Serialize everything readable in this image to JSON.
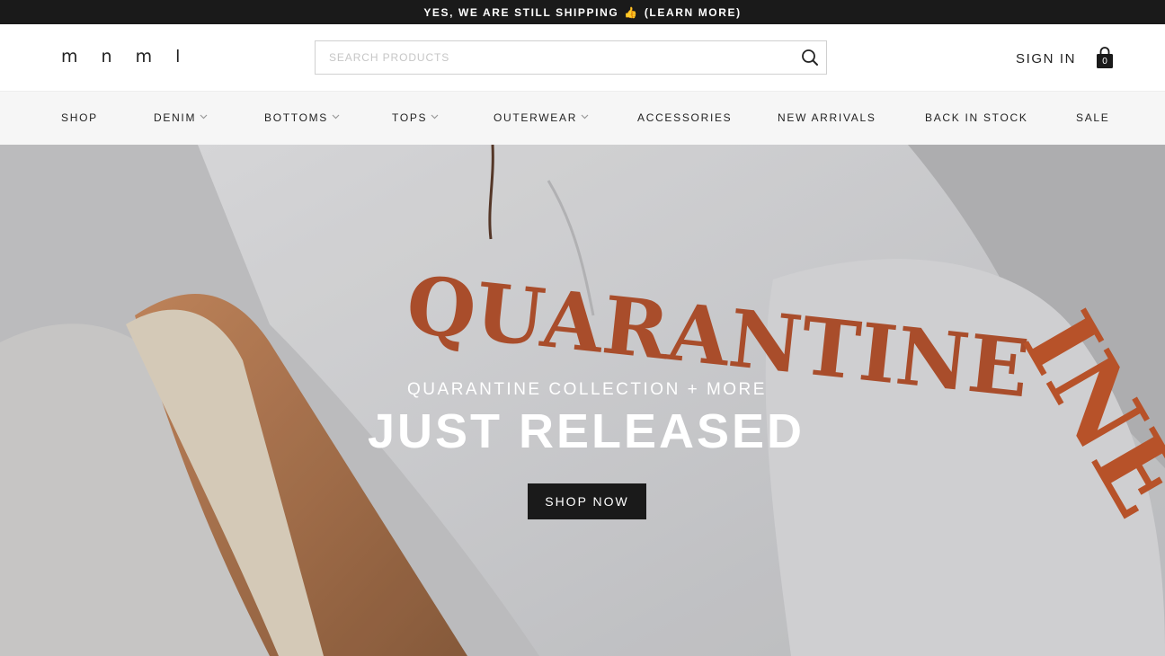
{
  "announcement": {
    "text": "YES, WE ARE STILL SHIPPING",
    "emoji": "👍",
    "link": "(LEARN MORE)"
  },
  "header": {
    "logo": "m n m l",
    "search_placeholder": "SEARCH PRODUCTS",
    "search_icon": "search-icon",
    "sign_in": "SIGN IN",
    "cart_icon": "shopping-bag-icon",
    "cart_count": "0"
  },
  "nav": {
    "items": [
      {
        "label": "SHOP",
        "dropdown": false
      },
      {
        "label": "DENIM",
        "dropdown": true
      },
      {
        "label": "BOTTOMS",
        "dropdown": true
      },
      {
        "label": "TOPS",
        "dropdown": true
      },
      {
        "label": "OUTERWEAR",
        "dropdown": true
      },
      {
        "label": "ACCESSORIES",
        "dropdown": false
      },
      {
        "label": "NEW ARRIVALS",
        "dropdown": false
      },
      {
        "label": "BACK IN STOCK",
        "dropdown": false
      },
      {
        "label": "SALE",
        "dropdown": false
      }
    ]
  },
  "hero": {
    "subtitle": "QUARANTINE COLLECTION + MORE",
    "title": "JUST RELEASED",
    "cta": "SHOP NOW",
    "graphic_text": "QUARANTINE",
    "sleeve_text": "INE"
  },
  "colors": {
    "announcement_bg": "#1a1a1a",
    "nav_bg": "#f6f6f6",
    "cta_bg": "#1a1a1a",
    "print_color": "#b4522e"
  }
}
